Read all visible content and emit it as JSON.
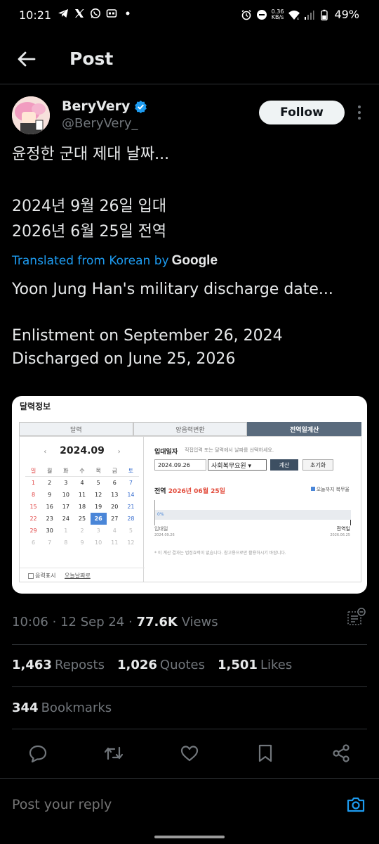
{
  "status_bar": {
    "time": "10:21",
    "net_speed_value": "0.36",
    "net_speed_unit": "KB/s",
    "battery": "49%",
    "left_icons": [
      "telegram-icon",
      "x-icon",
      "whatsapp-icon",
      "messages-icon",
      "dot-icon"
    ],
    "right_icons": [
      "alarm-icon",
      "dnd-icon",
      "wifi-icon",
      "signal-icon",
      "battery-icon"
    ]
  },
  "header": {
    "title": "Post"
  },
  "author": {
    "name": "BeryVery",
    "handle": "@BeryVery_",
    "verified": true,
    "follow_label": "Follow"
  },
  "tweet": {
    "line1": "윤정한 군대 제대 날짜...",
    "line2": "2024년 9월 26일 입대",
    "line3": "2026년 6월 25일 전역",
    "translated_prefix": "Translated from Korean by",
    "translated_brand": "Google",
    "tr_line1": "Yoon Jung Han's military discharge date...",
    "tr_line2": "Enlistment on September 26, 2024",
    "tr_line3": "Discharged on June 25, 2026"
  },
  "media": {
    "title": "달력정보",
    "tabs": [
      "달력",
      "양음력변환",
      "전역일계산"
    ],
    "active_tab": 2,
    "calendar": {
      "month": "2024.09",
      "prev": "‹",
      "next": "›",
      "weekdays": [
        "일",
        "월",
        "화",
        "수",
        "목",
        "금",
        "토"
      ],
      "weeks": [
        [
          "1",
          "2",
          "3",
          "4",
          "5",
          "6",
          "7"
        ],
        [
          "8",
          "9",
          "10",
          "11",
          "12",
          "13",
          "14"
        ],
        [
          "15",
          "16",
          "17",
          "18",
          "19",
          "20",
          "21"
        ],
        [
          "22",
          "23",
          "24",
          "25",
          "26",
          "27",
          "28"
        ],
        [
          "29",
          "30",
          "1",
          "2",
          "3",
          "4",
          "5"
        ],
        [
          "6",
          "7",
          "8",
          "9",
          "10",
          "11",
          "12"
        ]
      ],
      "selected": "26",
      "footer_checkbox": "음력표시",
      "footer_link": "오늘날짜로"
    },
    "calc": {
      "label": "입대일자",
      "hint": "직접입력 또는 달력에서 날짜를 선택하세요.",
      "date_value": "2024.09.26",
      "service_value": "사회복무요원",
      "calc_btn": "계산",
      "reset_btn": "초기화",
      "result_prefix": "전역",
      "result_date": "2026년 06월 25일",
      "legend": "오늘까지 복무율",
      "progress_percent": 0,
      "progress_text": "0%",
      "start_label": "입대일",
      "start_date": "2024.09.26",
      "end_label": "전역일",
      "end_date": "2026.06.25",
      "note": "* 이 계산 결과는 법정효력이 없습니다. 참고용으로만 활용하시기 바랍니다."
    }
  },
  "meta": {
    "time": "10:06",
    "sep": "·",
    "date": "12 Sep 24",
    "views_count": "77.6K",
    "views_label": "Views"
  },
  "stats": {
    "reposts_count": "1,463",
    "reposts_label": "Reposts",
    "quotes_count": "1,026",
    "quotes_label": "Quotes",
    "likes_count": "1,501",
    "likes_label": "Likes",
    "bookmarks_count": "344",
    "bookmarks_label": "Bookmarks"
  },
  "actions": [
    "reply-icon",
    "repost-icon",
    "like-icon",
    "bookmark-icon",
    "share-icon"
  ],
  "reply": {
    "placeholder": "Post your reply"
  },
  "colors": {
    "accent": "#1d9bf0",
    "text": "#e7e9ea",
    "muted": "#71767b",
    "border": "#2f3336"
  }
}
